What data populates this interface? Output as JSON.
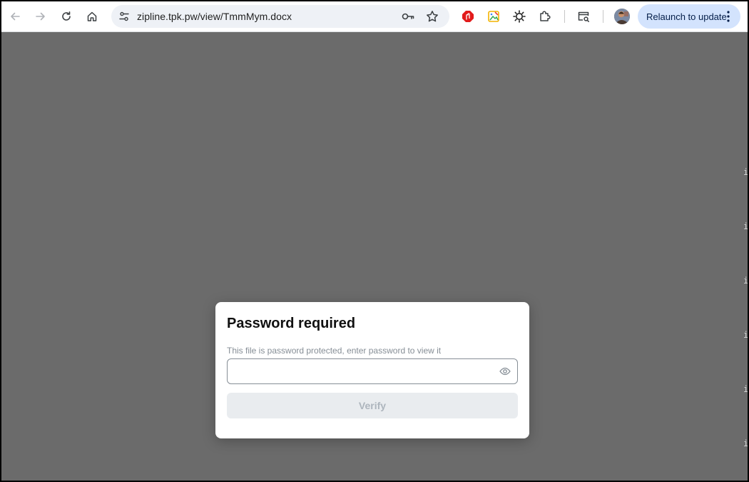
{
  "browser": {
    "url": "zipline.tpk.pw/view/TmmMym.docx",
    "relaunch_label": "Relaunch to update",
    "icons": {
      "back": "back-arrow-icon",
      "forward": "forward-arrow-icon",
      "reload": "reload-icon",
      "home": "home-icon",
      "site_info": "tune-icon",
      "passwords": "key-icon",
      "bookmark": "star-icon",
      "ext1": "adblock-extension-icon",
      "ext2": "image-extension-icon",
      "ext3": "sun-extension-icon",
      "extensions": "puzzle-icon",
      "search_tab": "tab-search-icon",
      "profile": "avatar",
      "menu": "kebab-menu-icon"
    }
  },
  "edge_marks": [
    "i",
    "i",
    "i",
    "i",
    "i",
    "i"
  ],
  "dialog": {
    "title": "Password required",
    "description": "This file is password protected, enter password to view it",
    "password_value": "",
    "verify_label": "Verify"
  },
  "colors": {
    "overlay": "#6b6b6b",
    "relaunch_bg": "#d3e3fd",
    "verify_bg": "#e9ecef",
    "verify_text": "#adb5bd"
  }
}
